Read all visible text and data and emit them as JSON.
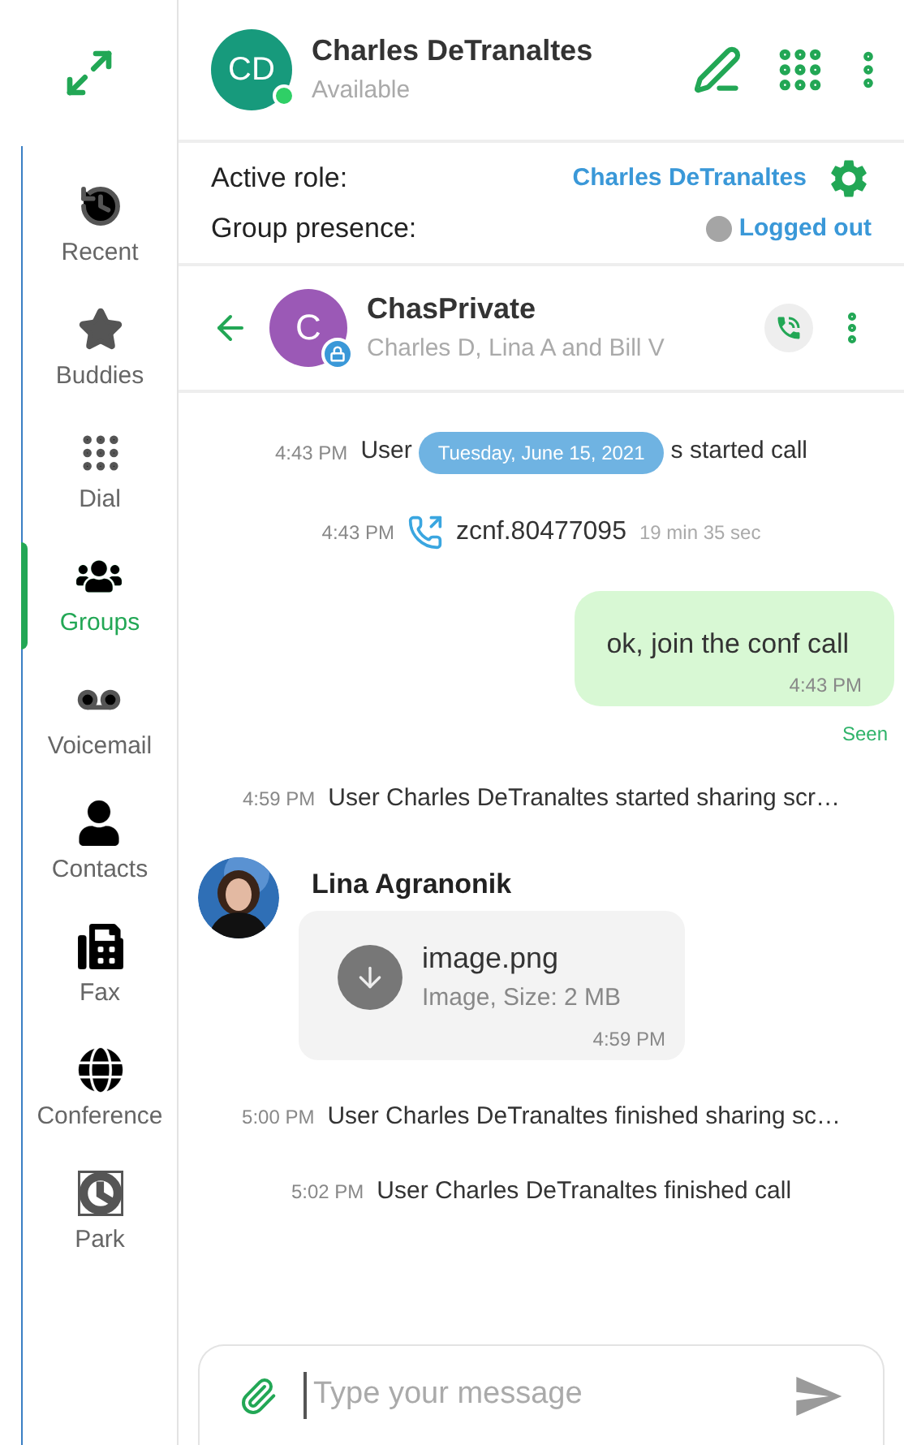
{
  "sidebar": {
    "items": [
      {
        "label": "Recent",
        "selected": false
      },
      {
        "label": "Buddies",
        "selected": false
      },
      {
        "label": "Dial",
        "selected": false
      },
      {
        "label": "Groups",
        "selected": true
      },
      {
        "label": "Voicemail",
        "selected": false
      },
      {
        "label": "Contacts",
        "selected": false
      },
      {
        "label": "Fax",
        "selected": false
      },
      {
        "label": "Conference",
        "selected": false
      },
      {
        "label": "Park",
        "selected": false
      }
    ]
  },
  "user": {
    "initials": "CD",
    "name": "Charles DeTranaltes",
    "status": "Available",
    "online": true
  },
  "roles": {
    "active_role_label": "Active role:",
    "active_role": "Charles DeTranaltes",
    "group_presence_label": "Group presence:",
    "group_presence": "Logged out"
  },
  "conversation": {
    "initial": "C",
    "name": "ChasPrivate",
    "members": "Charles D, Lina A and Bill V",
    "locked": true
  },
  "messages": [
    {
      "kind": "event",
      "time": "4:43 PM",
      "text_before": "User",
      "date_badge": "Tuesday, June 15, 2021",
      "text_after": "s started call"
    },
    {
      "kind": "call",
      "time": "4:43 PM",
      "number": "zcnf.80477095",
      "duration": "19 min 35 sec"
    },
    {
      "kind": "outgoing",
      "text": "ok, join the conf call",
      "time": "4:43 PM",
      "status": "Seen"
    },
    {
      "kind": "event",
      "time": "4:59 PM",
      "text": "User Charles DeTranaltes started sharing scr…"
    },
    {
      "kind": "file",
      "sender": "Lina Agranonik",
      "file_name": "image.png",
      "details": "Image, Size: 2 MB",
      "time": "4:59 PM"
    },
    {
      "kind": "event",
      "time": "5:00 PM",
      "text": "User Charles DeTranaltes finished sharing sc…"
    },
    {
      "kind": "event",
      "time": "5:02 PM",
      "text": "User Charles DeTranaltes finished call"
    }
  ],
  "composer": {
    "placeholder": "Type your message"
  }
}
